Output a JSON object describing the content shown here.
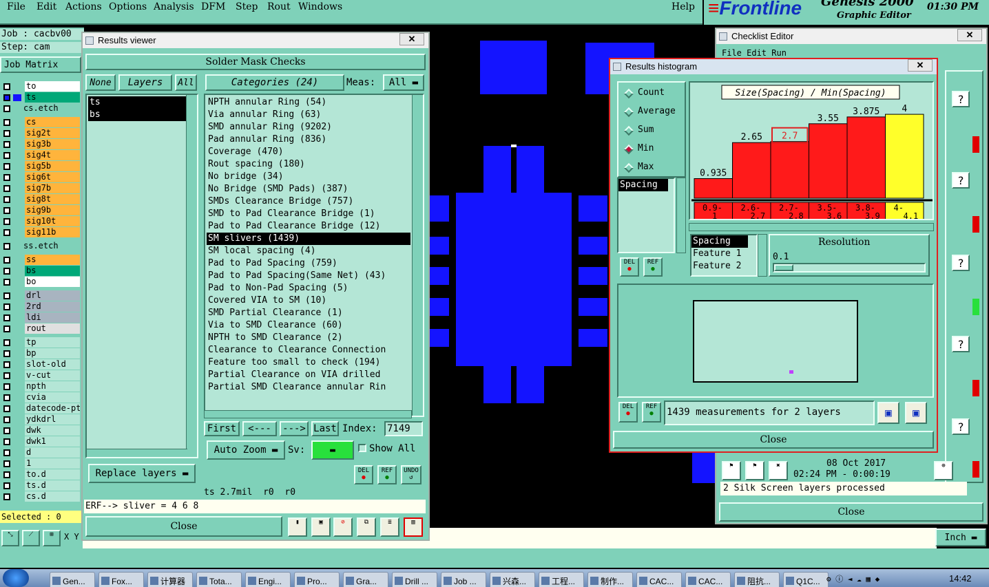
{
  "menu": {
    "file": "File",
    "edit": "Edit",
    "actions": "Actions",
    "options": "Options",
    "analysis": "Analysis",
    "dfm": "DFM",
    "step": "Step",
    "rout": "Rout",
    "windows": "Windows",
    "help": "Help"
  },
  "brand": {
    "logo": "Frontline",
    "product": "Genesis 2000",
    "subtitle": "Graphic Editor",
    "time": "01:30 PM"
  },
  "left": {
    "job_label": "Job : cacbv00",
    "step_label": "Step: cam",
    "matrix_label": "Job Matrix",
    "selected_label": "Selected : 0",
    "layers": [
      {
        "name": "to",
        "color": "#ffffff"
      },
      {
        "name": "ts",
        "color": "#00a878"
      },
      {
        "name": "cs.etch",
        "color": "#7fd1b9"
      },
      {
        "name": "cs",
        "color": "#ffb43c"
      },
      {
        "name": "sig2t",
        "color": "#ffb43c"
      },
      {
        "name": "sig3b",
        "color": "#ffb43c"
      },
      {
        "name": "sig4t",
        "color": "#ffb43c"
      },
      {
        "name": "sig5b",
        "color": "#ffb43c"
      },
      {
        "name": "sig6t",
        "color": "#ffb43c"
      },
      {
        "name": "sig7b",
        "color": "#ffb43c"
      },
      {
        "name": "sig8t",
        "color": "#ffb43c"
      },
      {
        "name": "sig9b",
        "color": "#ffb43c"
      },
      {
        "name": "sig10t",
        "color": "#ffb43c"
      },
      {
        "name": "sig11b",
        "color": "#ffb43c"
      },
      {
        "name": "ss.etch",
        "color": "#7fd1b9"
      },
      {
        "name": "ss",
        "color": "#ffb43c"
      },
      {
        "name": "bs",
        "color": "#00a878"
      },
      {
        "name": "bo",
        "color": "#ffffff"
      },
      {
        "name": "drl",
        "color": "#a8b4c0"
      },
      {
        "name": "2rd",
        "color": "#a8b4c0"
      },
      {
        "name": "ldi",
        "color": "#a8b4c0"
      },
      {
        "name": "rout",
        "color": "#e0e0e0"
      },
      {
        "name": "tp",
        "color": "#b4e6d6"
      },
      {
        "name": "bp",
        "color": "#b4e6d6"
      },
      {
        "name": "slot-old",
        "color": "#b4e6d6"
      },
      {
        "name": "v-cut",
        "color": "#b4e6d6"
      },
      {
        "name": "npth",
        "color": "#b4e6d6"
      },
      {
        "name": "cvia",
        "color": "#b4e6d6"
      },
      {
        "name": "datecode-pt",
        "color": "#b4e6d6"
      },
      {
        "name": "ydkdrl",
        "color": "#b4e6d6"
      },
      {
        "name": "dwk",
        "color": "#b4e6d6"
      },
      {
        "name": "dwk1",
        "color": "#b4e6d6"
      },
      {
        "name": "d",
        "color": "#b4e6d6"
      },
      {
        "name": "1",
        "color": "#b4e6d6"
      },
      {
        "name": "to.d",
        "color": "#b4e6d6"
      },
      {
        "name": "ts.d",
        "color": "#b4e6d6"
      },
      {
        "name": "cs.d",
        "color": "#b4e6d6"
      }
    ]
  },
  "results_viewer": {
    "title": "Results viewer",
    "header": "Solder Mask Checks",
    "none_btn": "None",
    "layers_btn": "Layers",
    "all_btn": "All",
    "categories_btn": "Categories (24)",
    "meas_label": "Meas:",
    "meas_value": "All",
    "layer_list": [
      "ts",
      "bs"
    ],
    "categories": [
      "NPTH annular Ring (54)",
      "Via annular Ring (63)",
      "SMD annular Ring (9202)",
      "Pad annular Ring (836)",
      "Coverage (470)",
      "Rout spacing (180)",
      "No bridge (34)",
      "No Bridge (SMD Pads) (387)",
      "SMDs Clearance Bridge (757)",
      "SMD to Pad Clearance Bridge (1)",
      "Pad to Pad Clearance Bridge (12)",
      "SM slivers (1439)",
      "SM local spacing (4)",
      "Pad to Pad Spacing (759)",
      "Pad to Pad Spacing(Same Net) (43)",
      "Pad to Non-Pad Spacing (5)",
      "Covered VIA to SM (10)",
      "SMD Partial Clearance (1)",
      "Via to SMD Clearance (60)",
      "NPTH to SMD Clearance (2)",
      "Clearance to Clearance Connection",
      "Feature too small to check (194)",
      "Partial Clearance on VIA drilled",
      "Partial SMD Clearance annular Rin"
    ],
    "first": "First",
    "prev": "<---",
    "next": "--->",
    "last": "Last",
    "index_label": "Index:",
    "index_value": "7149",
    "autozoom": "Auto Zoom",
    "sv_label": "Sv:",
    "show_all": "Show All",
    "replace_layers": "Replace layers",
    "del": "DEL",
    "ref": "REF",
    "undo": "UNDO",
    "status1": "ts 2.7mil  r0  r0",
    "status2": "ERF--> sliver = 4 6 8",
    "close": "Close"
  },
  "histogram": {
    "title": "Results histogram",
    "radios": [
      "Count",
      "Average",
      "Sum",
      "Min",
      "Max"
    ],
    "selected_radio": "Min",
    "chart_title": "Size(Spacing) / Min(Spacing)",
    "metric_list": [
      "Spacing"
    ],
    "feature_list": [
      "Spacing",
      "Feature 1",
      "Feature 2"
    ],
    "resolution_label": "Resolution",
    "resolution_value": "0.1",
    "measurements": "1439 measurements for 2 layers",
    "close": "Close",
    "del": "DEL",
    "ref": "REF",
    "highlight_color": "#e02020"
  },
  "chart_data": {
    "type": "bar",
    "title": "Size(Spacing) / Min(Spacing)",
    "categories": [
      "0.9-1",
      "2.6-2.7",
      "2.7-2.8",
      "3.5-3.6",
      "3.8-3.9",
      "4-4.1"
    ],
    "values": [
      0.935,
      2.65,
      2.7,
      3.55,
      3.875,
      4
    ],
    "value_labels": [
      "0.935",
      "2.65",
      "2.7",
      "3.55",
      "3.875",
      "4"
    ],
    "bin_top": [
      "0.9-",
      "2.6-",
      "2.7-",
      "3.5-",
      "3.8-",
      "4-"
    ],
    "bin_bottom": [
      "1",
      "2.7",
      "2.8",
      "3.6",
      "3.9",
      "4.1"
    ],
    "colors": [
      "#ff1a1a",
      "#ff1a1a",
      "#ff1a1a",
      "#ff1a1a",
      "#ff1a1a",
      "#ffff2a"
    ],
    "highlighted_index": 2,
    "ylim": [
      0,
      4.2
    ]
  },
  "checklist": {
    "title": "Checklist Editor",
    "menu": "File Edit Run",
    "date": "08 Oct 2017",
    "time": "02:24 PM - 0:00:19",
    "status": "2 Silk Screen layers processed",
    "close": "Close",
    "help": "?"
  },
  "bottom": {
    "unit": "Inch",
    "coords": "X Y"
  },
  "taskbar": {
    "items": [
      "Gen...",
      "Fox...",
      "计算器",
      "Tota...",
      "Engi...",
      "Pro...",
      "Gra...",
      "Drill ...",
      "Job ...",
      "兴森...",
      "工程...",
      "制作...",
      "CAC...",
      "CAC...",
      "阻抗...",
      "Q1C..."
    ],
    "clock": "14:42"
  }
}
